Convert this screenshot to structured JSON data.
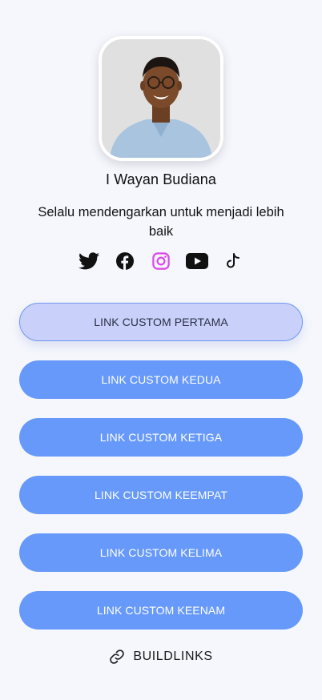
{
  "profile": {
    "name": "I Wayan Budiana",
    "bio": "Selalu mendengarkan untuk menjadi lebih baik"
  },
  "socials": [
    {
      "icon": "twitter-icon",
      "color": "#111111"
    },
    {
      "icon": "facebook-icon",
      "color": "#111111"
    },
    {
      "icon": "instagram-icon",
      "color": "#d946ef"
    },
    {
      "icon": "youtube-icon",
      "color": "#111111"
    },
    {
      "icon": "tiktok-icon",
      "color": "#111111"
    }
  ],
  "links": [
    {
      "label": "LINK CUSTOM PERTAMA",
      "state": "active"
    },
    {
      "label": "LINK CUSTOM KEDUA"
    },
    {
      "label": "LINK CUSTOM KETIGA"
    },
    {
      "label": "LINK CUSTOM KEEMPAT"
    },
    {
      "label": "LINK CUSTOM KELIMA"
    },
    {
      "label": "LINK CUSTOM KEENAM"
    }
  ],
  "footer": {
    "label": "BUILDLINKS",
    "icon": "link-icon"
  },
  "colors": {
    "background": "#f5f7fc",
    "button": "#6699fa",
    "button_active": "#c9d1fa",
    "button_active_border": "#6f97f2",
    "instagram": "#d946ef"
  }
}
